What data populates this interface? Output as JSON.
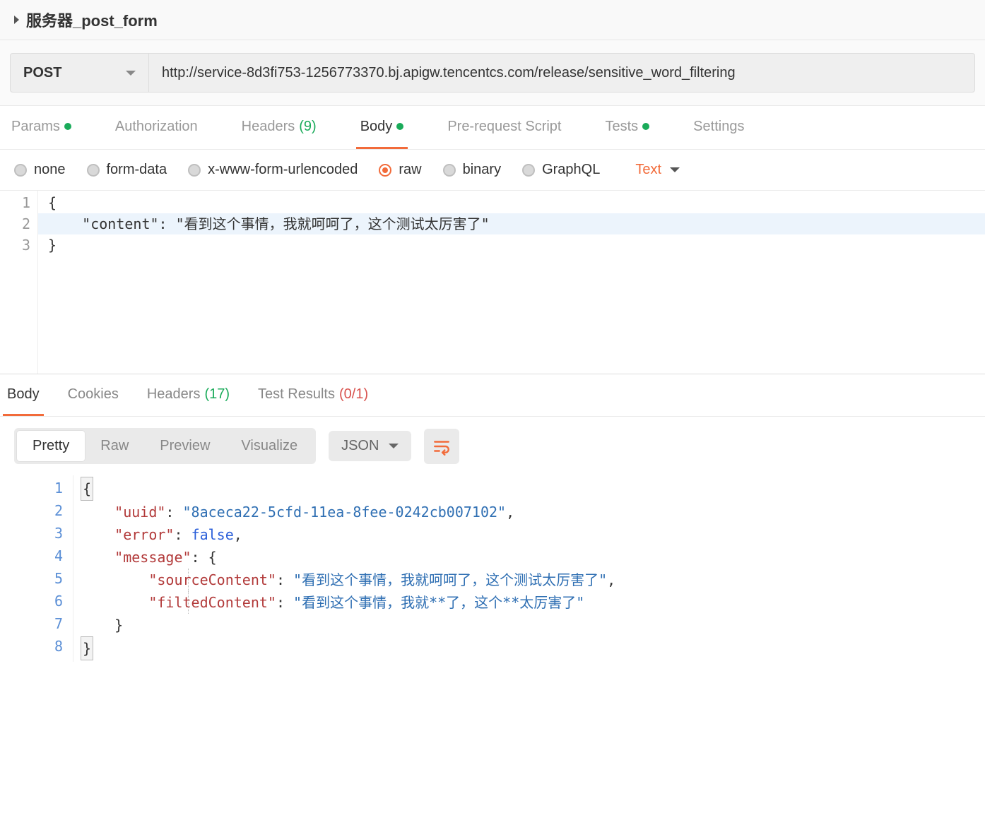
{
  "request": {
    "name": "服务器_post_form",
    "method": "POST",
    "url": "http://service-8d3fi753-1256773370.bj.apigw.tencentcs.com/release/sensitive_word_filtering"
  },
  "tabs": {
    "params": "Params",
    "auth": "Authorization",
    "headers": "Headers",
    "headers_count": "(9)",
    "body": "Body",
    "prereq": "Pre-request Script",
    "tests": "Tests",
    "settings": "Settings"
  },
  "body_opts": {
    "none": "none",
    "formdata": "form-data",
    "xwww": "x-www-form-urlencoded",
    "raw": "raw",
    "binary": "binary",
    "graphql": "GraphQL",
    "content_type": "Text"
  },
  "editor": {
    "lines": [
      "1",
      "2",
      "3"
    ],
    "l1": "{",
    "l2": "    \"content\": \"看到这个事情，我就呵呵了，这个测试太厉害了\"",
    "l3": "}"
  },
  "res_tabs": {
    "body": "Body",
    "cookies": "Cookies",
    "headers": "Headers",
    "headers_count": "(17)",
    "test_results": "Test Results",
    "test_results_count": "(0/1)"
  },
  "res_toolbar": {
    "pretty": "Pretty",
    "raw": "Raw",
    "preview": "Preview",
    "visualize": "Visualize",
    "format": "JSON"
  },
  "response": {
    "lines": [
      "1",
      "2",
      "3",
      "4",
      "5",
      "6",
      "7",
      "8"
    ],
    "k_uuid": "\"uuid\"",
    "v_uuid": "\"8aceca22-5cfd-11ea-8fee-0242cb007102\"",
    "k_error": "\"error\"",
    "v_error": "false",
    "k_message": "\"message\"",
    "k_source": "\"sourceContent\"",
    "v_source": "\"看到这个事情，我就呵呵了，这个测试太厉害了\"",
    "k_filted": "\"filtedContent\"",
    "v_filted": "\"看到这个事情，我就**了，这个**太厉害了\""
  }
}
